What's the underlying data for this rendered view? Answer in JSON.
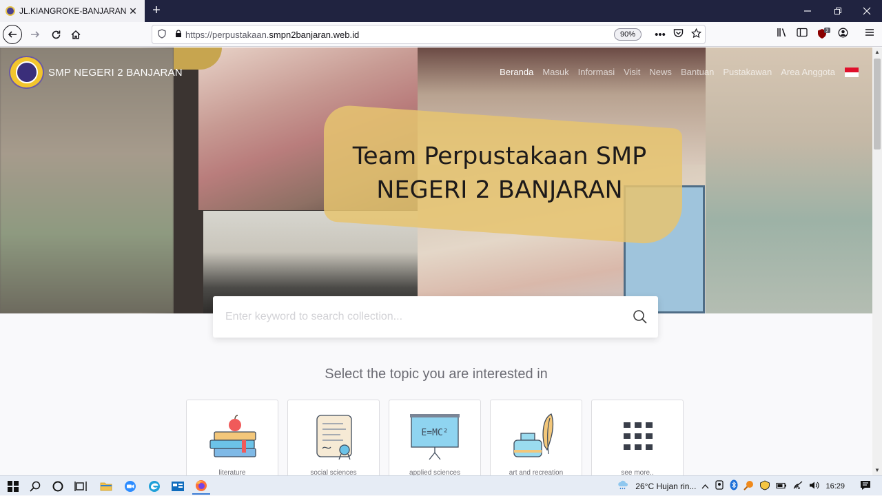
{
  "browser": {
    "tab_title": "JL.KIANGROKE-BANJARAN KM",
    "tab_close": "✕",
    "new_tab": "+",
    "url_prefix": "https://perpustakaan.",
    "url_domain": "smpn2banjaran.web.id",
    "zoom": "90%",
    "page_actions": "•••"
  },
  "site": {
    "name": "SMP NEGERI 2 BANJARAN",
    "menu": [
      "Beranda",
      "Masuk",
      "Informasi",
      "Visit",
      "News",
      "Bantuan",
      "Pustakawan",
      "Area Anggota"
    ]
  },
  "hero": {
    "title": "Team Perpustakaan SMP NEGERI 2 BANJARAN"
  },
  "search": {
    "placeholder": "Enter keyword to search collection..."
  },
  "topics": {
    "heading": "Select the topic you are interested in",
    "items": [
      {
        "label": "literature",
        "icon": "books-apple-icon"
      },
      {
        "label": "social sciences",
        "icon": "diploma-scroll-icon"
      },
      {
        "label": "applied sciences",
        "icon": "emc2-board-icon"
      },
      {
        "label": "art and recreation",
        "icon": "ink-feather-icon"
      },
      {
        "label": "see more..",
        "icon": "grid-icon"
      }
    ]
  },
  "taskbar": {
    "weather": "26°C  Hujan rin...",
    "time": "16:29"
  },
  "colors": {
    "tabbar": "#202340",
    "accent_yellow": "#e6c470",
    "page_bg": "#f9f9fb"
  }
}
